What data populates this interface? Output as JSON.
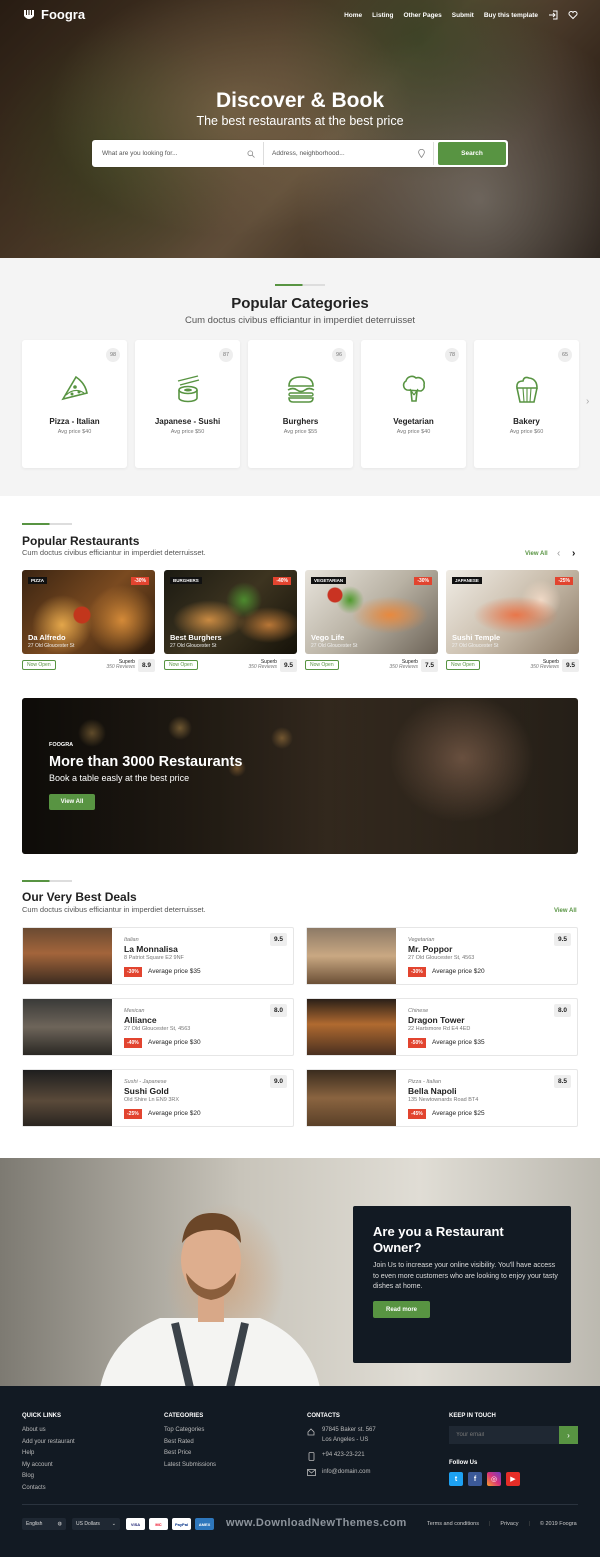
{
  "brand": {
    "name": "Foogra",
    "accent": "#589442"
  },
  "nav": {
    "items": [
      "Home",
      "Listing",
      "Other Pages",
      "Submit",
      "Buy this template"
    ]
  },
  "hero": {
    "title": "Discover & Book",
    "subtitle": "The best restaurants at the best price",
    "search_placeholder": "What are you looking for...",
    "address_placeholder": "Address, neighborhood...",
    "search_button": "Search"
  },
  "categories": {
    "title": "Popular Categories",
    "subtitle": "Cum doctus civibus efficiantur in imperdiet deterruisset",
    "items": [
      {
        "name": "Pizza - Italian",
        "price": "Avg price $40",
        "count": "98",
        "icon": "pizza-icon"
      },
      {
        "name": "Japanese - Sushi",
        "price": "Avg price $50",
        "count": "87",
        "icon": "sushi-icon"
      },
      {
        "name": "Burghers",
        "price": "Avg price $55",
        "count": "96",
        "icon": "burger-icon"
      },
      {
        "name": "Vegetarian",
        "price": "Avg price $40",
        "count": "78",
        "icon": "broccoli-icon"
      },
      {
        "name": "Bakery",
        "price": "Avg price $60",
        "count": "65",
        "icon": "cupcake-icon"
      }
    ]
  },
  "popular": {
    "title": "Popular Restaurants",
    "subtitle": "Cum doctus civibus efficiantur in imperdiet deterruisset.",
    "view_all": "View All",
    "items": [
      {
        "tag": "PIZZA",
        "discount": "-30%",
        "name": "Da Alfredo",
        "address": "27 Old Gloucester St",
        "status": "Now Open",
        "rating_label": "Superb",
        "reviews": "350 Reviews",
        "score": "8.9"
      },
      {
        "tag": "BURGHERS",
        "discount": "-40%",
        "name": "Best Burghers",
        "address": "27 Old Gloucester St",
        "status": "Now Open",
        "rating_label": "Superb",
        "reviews": "350 Reviews",
        "score": "9.5"
      },
      {
        "tag": "VEGETARIAN",
        "discount": "-30%",
        "name": "Vego Life",
        "address": "27 Old Gloucester St",
        "status": "Now Open",
        "rating_label": "Superb",
        "reviews": "350 Reviews",
        "score": "7.5"
      },
      {
        "tag": "JAPANESE",
        "discount": "-25%",
        "name": "Sushi Temple",
        "address": "27 Old Gloucester St",
        "status": "Now Open",
        "rating_label": "Superb",
        "reviews": "350 Reviews",
        "score": "9.5"
      }
    ]
  },
  "banner": {
    "kicker": "FOOGRA",
    "title": "More than 3000 Restaurants",
    "subtitle": "Book a table easly at the best price",
    "button": "View All"
  },
  "deals": {
    "title": "Our Very Best Deals",
    "subtitle": "Cum doctus civibus efficiantur in imperdiet deterruisset.",
    "view_all": "View All",
    "items": [
      {
        "category": "Italian",
        "name": "La Monnalisa",
        "address": "8 Patriot Square E2 9NF",
        "discount": "-30%",
        "price": "Average price $35",
        "score": "9.5"
      },
      {
        "category": "Vegetarian",
        "name": "Mr. Poppor",
        "address": "27 Old Gloucester St, 4563",
        "discount": "-30%",
        "price": "Average price $20",
        "score": "9.5"
      },
      {
        "category": "Mexican",
        "name": "Alliance",
        "address": "27 Old Gloucester St, 4563",
        "discount": "-40%",
        "price": "Average price $30",
        "score": "8.0"
      },
      {
        "category": "Chinese",
        "name": "Dragon Tower",
        "address": "22 Hartsmore Rd E4 4ED",
        "discount": "-50%",
        "price": "Average price $35",
        "score": "8.0"
      },
      {
        "category": "Sushi - Japanese",
        "name": "Sushi Gold",
        "address": "Old Shire Ln EN9 3RX",
        "discount": "-25%",
        "price": "Average price $20",
        "score": "9.0"
      },
      {
        "category": "Pizza - Italian",
        "name": "Bella Napoli",
        "address": "135 Newtownards Road BT4",
        "discount": "-45%",
        "price": "Average price $25",
        "score": "8.5"
      }
    ]
  },
  "owner": {
    "title": "Are you a Restaurant Owner?",
    "text": "Join Us to increase your online visibility. You'll have access to even more customers who are looking to enjoy your tasty dishes at home.",
    "button": "Read more"
  },
  "footer": {
    "quick_links": {
      "title": "QUICK LINKS",
      "items": [
        "About us",
        "Add your restaurant",
        "Help",
        "My account",
        "Blog",
        "Contacts"
      ]
    },
    "categories": {
      "title": "CATEGORIES",
      "items": [
        "Top Categories",
        "Best Rated",
        "Best Price",
        "Latest Submissions"
      ]
    },
    "contacts": {
      "title": "CONTACTS",
      "address_line1": "97845 Baker st. 567",
      "address_line2": "Los Angeles - US",
      "phone": "+94 423-23-221",
      "email": "info@domain.com"
    },
    "keep_in_touch": {
      "title": "KEEP IN TOUCH",
      "email_placeholder": "Your email",
      "follow": "Follow Us"
    },
    "language": "English",
    "currency": "US Dollars",
    "cards": [
      "VISA",
      "MC",
      "PayPal",
      "AMEX"
    ],
    "watermark": "www.DownloadNewThemes.com",
    "bottom_links": [
      "Terms and conditions",
      "Privacy",
      "© 2019 Foogra"
    ]
  }
}
